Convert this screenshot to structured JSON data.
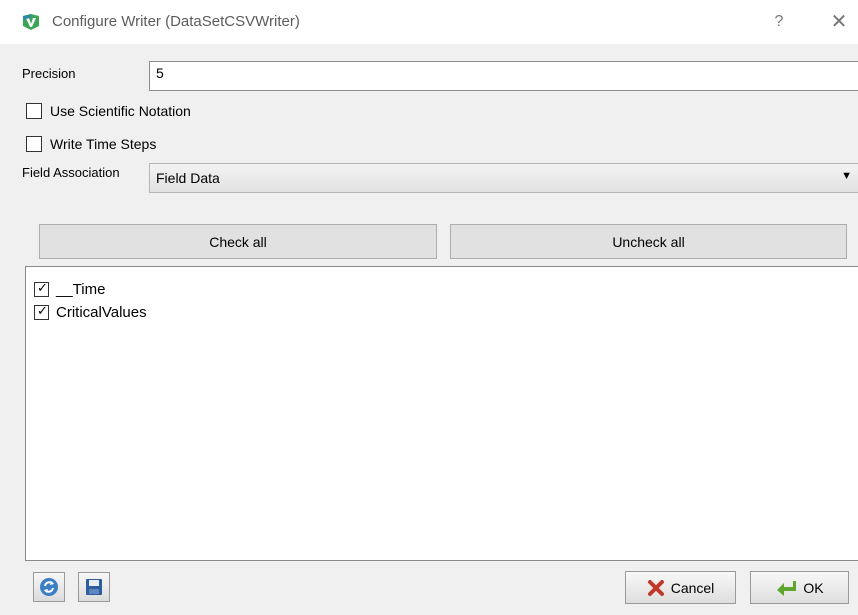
{
  "window": {
    "title": "Configure Writer (DataSetCSVWriter)",
    "help_label": "?",
    "close_label": "✕",
    "app_icon": "paraview-icon"
  },
  "form": {
    "precision_label": "Precision",
    "precision_value": "5",
    "scientific_label": "Use Scientific Notation",
    "scientific_checked": false,
    "timesteps_label": "Write Time Steps",
    "timesteps_checked": false,
    "field_assoc_label": "Field Association",
    "field_assoc_value": "Field Data"
  },
  "buttons": {
    "check_all": "Check all",
    "uncheck_all": "Uncheck all",
    "cancel": "Cancel",
    "ok": "OK"
  },
  "arrays": [
    {
      "label": "__Time",
      "checked": true
    },
    {
      "label": "CriticalValues",
      "checked": true
    }
  ],
  "toolbar": {
    "reset_icon": "refresh-icon",
    "save_icon": "save-icon"
  },
  "colors": {
    "dialog_bg": "#f0f0f0",
    "button_bg": "#e1e1e1"
  }
}
